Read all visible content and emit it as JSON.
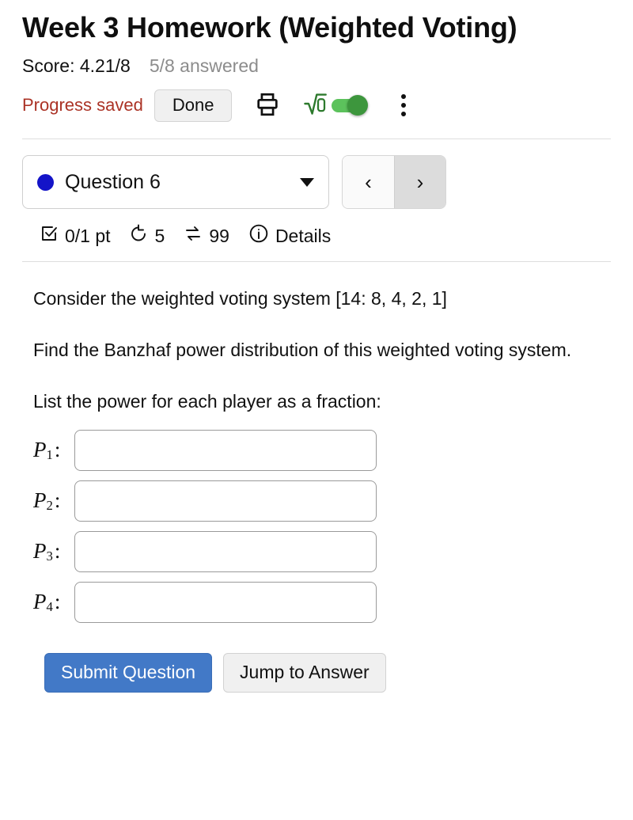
{
  "header": {
    "title": "Week 3 Homework (Weighted Voting)",
    "score_label": "Score: 4.21/8",
    "answered_label": "5/8 answered"
  },
  "toolbar": {
    "progress_status": "Progress saved",
    "done_label": "Done",
    "print_icon": "print-icon",
    "math_icon": "sqrt-icon",
    "math_toggle_state": "on",
    "menu_icon": "kebab-menu-icon",
    "accent_green_track": "#5cc25c",
    "accent_green_knob": "#3d963d",
    "progress_color": "#ab3326"
  },
  "question_nav": {
    "status_dot_color": "#1414c8",
    "selected_question": "Question 6",
    "caret_icon": "chevron-down-icon",
    "prev_label": "‹",
    "next_label": "›"
  },
  "stats": {
    "points_icon": "checkbox-checked-icon",
    "points_label": "0/1 pt",
    "attempts_icon": "undo-arrow-icon",
    "attempts_label": "5",
    "exchange_icon": "swap-arrows-icon",
    "exchange_label": "99",
    "info_icon": "info-circle-icon",
    "details_label": "Details"
  },
  "question": {
    "paragraph_1": "Consider the weighted voting system [14: 8, 4, 2, 1]",
    "paragraph_2": "Find the Banzhaf power distribution of this weighted voting system.",
    "paragraph_3": "List the power for each player as a fraction:",
    "answers": [
      {
        "label_base": "P",
        "label_sub": "1",
        "value": "",
        "placeholder": ""
      },
      {
        "label_base": "P",
        "label_sub": "2",
        "value": "",
        "placeholder": ""
      },
      {
        "label_base": "P",
        "label_sub": "3",
        "value": "",
        "placeholder": ""
      },
      {
        "label_base": "P",
        "label_sub": "4",
        "value": "",
        "placeholder": ""
      }
    ]
  },
  "actions": {
    "submit_label": "Submit Question",
    "submit_color": "#4279c7",
    "jump_label": "Jump to Answer"
  }
}
